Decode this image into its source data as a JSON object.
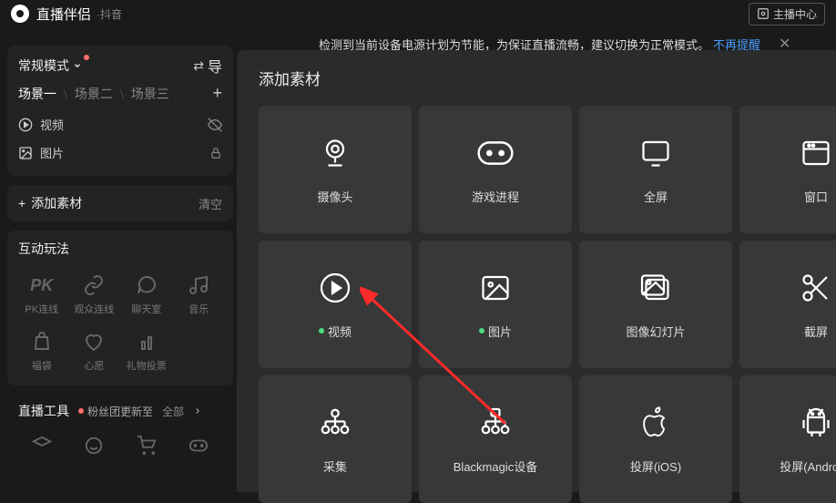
{
  "header": {
    "title": "直播伴侣",
    "sub": "·抖音",
    "anchor_center": "主播中心"
  },
  "warn": {
    "text": "检测到当前设备电源计划为节能，为保证直播流畅，建议切换为正常模式。",
    "link": "不再提醒"
  },
  "mode": {
    "label": "常规模式",
    "swap_label": "导"
  },
  "scenes": {
    "tabs": [
      "场景一",
      "场景二",
      "场景三"
    ],
    "active": 0
  },
  "assets": [
    {
      "icon": "play-circle",
      "label": "视频",
      "right": "eye-off"
    },
    {
      "icon": "image",
      "label": "图片",
      "right": "lock"
    }
  ],
  "actions": {
    "add": "添加素材",
    "clear": "清空"
  },
  "interaction": {
    "title": "互动玩法",
    "items": [
      {
        "icon": "pk",
        "label": "PK连线"
      },
      {
        "icon": "link",
        "label": "观众连线"
      },
      {
        "icon": "chat",
        "label": "聊天室"
      },
      {
        "icon": "music",
        "label": "音乐"
      },
      {
        "icon": "bag",
        "label": "福袋"
      },
      {
        "icon": "heart",
        "label": "心愿"
      },
      {
        "icon": "vote",
        "label": "礼物投票"
      },
      {
        "icon": "",
        "label": ""
      }
    ]
  },
  "tools": {
    "title": "直播工具",
    "new_text": "粉丝团更新至",
    "all": "全部"
  },
  "overlay": {
    "title": "添加素材",
    "cards": [
      {
        "icon": "camera",
        "label": "摄像头",
        "dot": false
      },
      {
        "icon": "gamepad",
        "label": "游戏进程",
        "dot": false
      },
      {
        "icon": "monitor",
        "label": "全屏",
        "dot": false
      },
      {
        "icon": "window",
        "label": "窗口",
        "dot": false
      },
      {
        "icon": "play",
        "label": "视频",
        "dot": true
      },
      {
        "icon": "image",
        "label": "图片",
        "dot": true
      },
      {
        "icon": "slides",
        "label": "图像幻灯片",
        "dot": false
      },
      {
        "icon": "scissors",
        "label": "截屏",
        "dot": false
      },
      {
        "icon": "capture",
        "label": "采集",
        "dot": false
      },
      {
        "icon": "blackmagic",
        "label": "Blackmagic设备",
        "dot": false
      },
      {
        "icon": "apple",
        "label": "投屏(iOS)",
        "dot": false
      },
      {
        "icon": "android",
        "label": "投屏(Android)",
        "dot": false
      }
    ]
  }
}
